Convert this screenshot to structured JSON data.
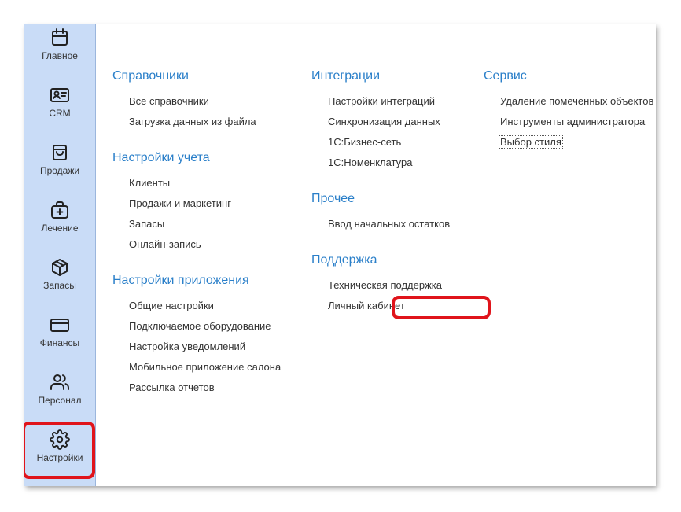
{
  "sidebar": {
    "items": [
      {
        "label": "Главное",
        "icon": "calendar-icon"
      },
      {
        "label": "CRM",
        "icon": "contact-card-icon"
      },
      {
        "label": "Продажи",
        "icon": "shopping-bag-icon"
      },
      {
        "label": "Лечение",
        "icon": "medical-bag-icon"
      },
      {
        "label": "Запасы",
        "icon": "box-icon"
      },
      {
        "label": "Финансы",
        "icon": "credit-card-icon"
      },
      {
        "label": "Персонал",
        "icon": "users-icon"
      },
      {
        "label": "Настройки",
        "icon": "gear-icon"
      }
    ],
    "active": "Настройки"
  },
  "sections": {
    "references": {
      "title": "Справочники",
      "links": [
        "Все справочники",
        "Загрузка данных из файла"
      ]
    },
    "accounting": {
      "title": "Настройки учета",
      "links": [
        "Клиенты",
        "Продажи и маркетинг",
        "Запасы",
        "Онлайн-запись"
      ]
    },
    "app": {
      "title": "Настройки приложения",
      "links": [
        "Общие настройки",
        "Подключаемое оборудование",
        "Настройка уведомлений",
        "Мобильное приложение салона",
        "Рассылка отчетов"
      ]
    },
    "integrations": {
      "title": "Интеграции",
      "links": [
        "Настройки интеграций",
        "Синхронизация данных",
        "1С:Бизнес-сеть",
        "1С:Номенклатура"
      ]
    },
    "other": {
      "title": "Прочее",
      "links": [
        "Ввод начальных остатков"
      ]
    },
    "support": {
      "title": "Поддержка",
      "links": [
        "Техническая поддержка",
        "Личный кабинет"
      ]
    },
    "service": {
      "title": "Сервис",
      "links": [
        "Удаление помеченных объектов",
        "Инструменты администратора",
        "Выбор стиля"
      ]
    }
  },
  "colors": {
    "sidebar_bg": "#c9dcf7",
    "heading": "#2a7fc9",
    "highlight": "#e0141b"
  }
}
